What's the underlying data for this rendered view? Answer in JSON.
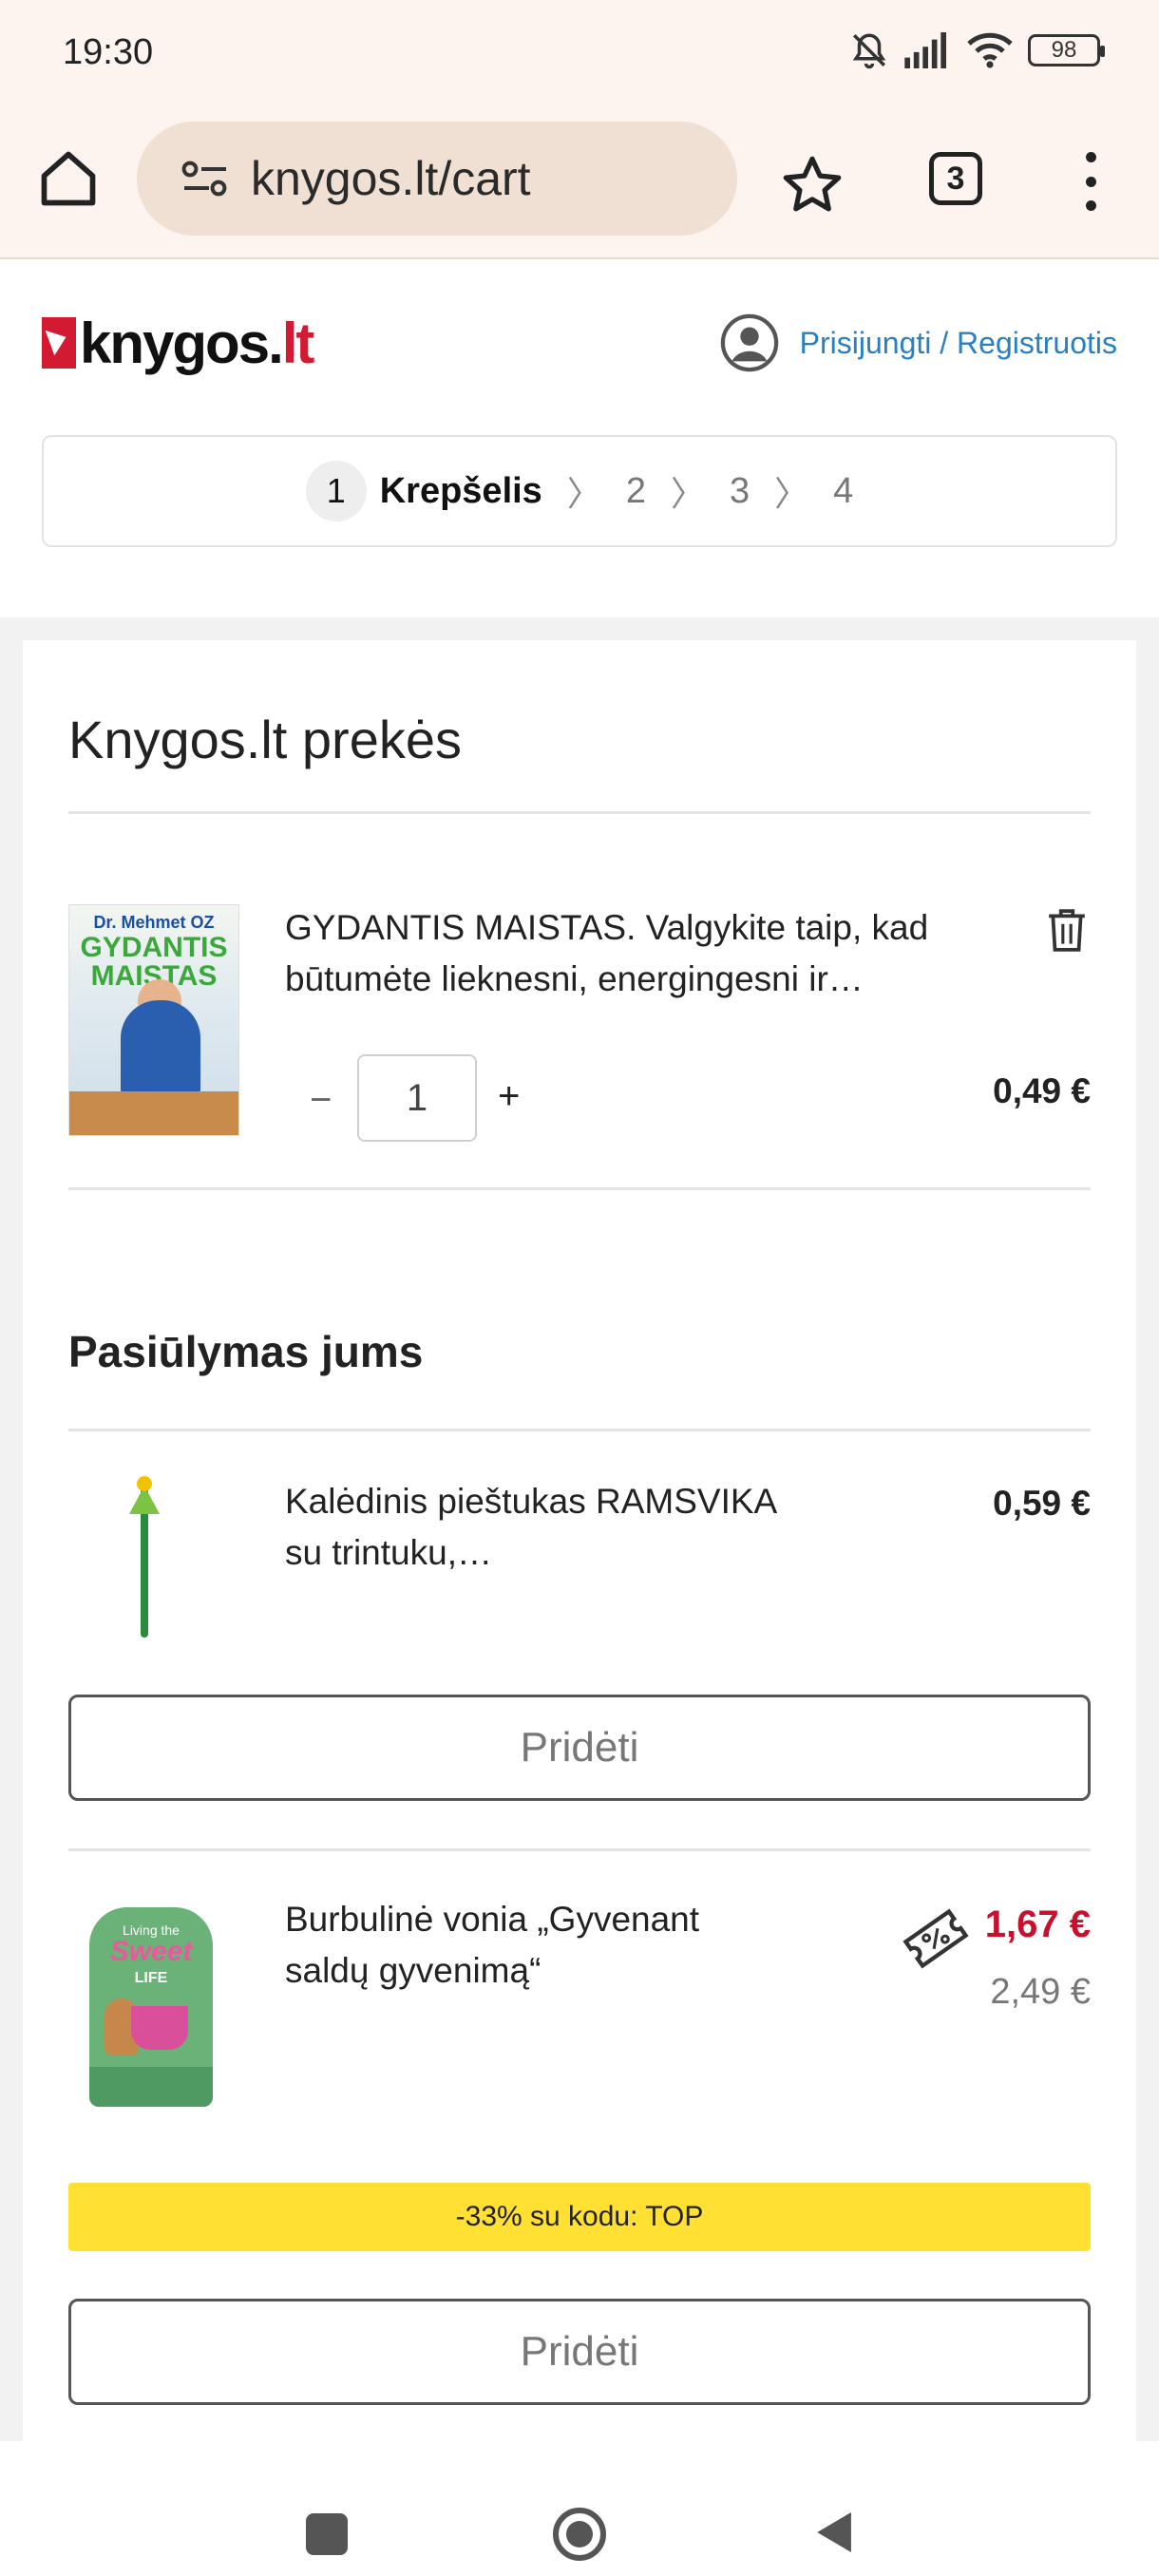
{
  "status_bar": {
    "time": "19:30",
    "battery": "98"
  },
  "browser": {
    "url": "knygos.lt/cart",
    "tab_count": "3"
  },
  "header": {
    "logo_main": "knygos",
    "logo_dot": ".",
    "logo_suffix": "lt",
    "login_label": "Prisijungti / Registruotis"
  },
  "steps": {
    "current_number": "1",
    "current_label": "Krepšelis",
    "others": [
      "2",
      "3",
      "4"
    ]
  },
  "cart": {
    "title": "Knygos.lt prekės",
    "item": {
      "cover_author": "Dr. Mehmet OZ",
      "cover_title": "GYDANTIS MAISTAS",
      "title": "GYDANTIS MAISTAS. Valgykite taip, kad būtumėte lieknesni, energingesni ir…",
      "quantity": "1",
      "minus": "−",
      "plus": "+",
      "price": "0,49 €"
    }
  },
  "suggestions": {
    "title": "Pasiūlymas jums",
    "items": [
      {
        "title": "Kalėdinis pieštukas RAMSVIKA su trintuku,…",
        "price": "0,59 €",
        "button": "Pridėti"
      },
      {
        "cover_living": "Living the",
        "cover_sweet": "Sweet",
        "cover_life": "LIFE",
        "title": "Burbulinė vonia „Gyvenant saldų gyvenimą“",
        "price": "1,67 €",
        "old_price": "2,49 €",
        "promo": "-33% su kodu: TOP",
        "button": "Pridėti"
      }
    ]
  },
  "colors": {
    "brand_red": "#d21b32",
    "link_blue": "#2a7fc1",
    "sale_red": "#c8102e",
    "promo_yellow": "#ffe033"
  }
}
